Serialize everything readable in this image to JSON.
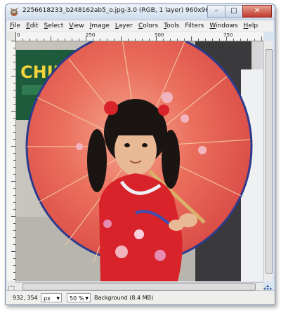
{
  "window": {
    "title": "2256618233_b248162ab5_o.jpg-3.0 (RGB, 1 layer) 960x960 – GIMP",
    "buttons": {
      "minimize": "–",
      "maximize": "□",
      "close": "✕"
    }
  },
  "menubar": {
    "items": [
      {
        "label": "File",
        "u": "F",
        "rest": "ile"
      },
      {
        "label": "Edit",
        "u": "E",
        "rest": "dit"
      },
      {
        "label": "Select",
        "u": "S",
        "rest": "elect"
      },
      {
        "label": "View",
        "u": "V",
        "rest": "iew"
      },
      {
        "label": "Image",
        "u": "I",
        "rest": "mage"
      },
      {
        "label": "Layer",
        "u": "L",
        "rest": "ayer"
      },
      {
        "label": "Colors",
        "u": "C",
        "rest": "olors"
      },
      {
        "label": "Tools",
        "u": "T",
        "rest": "ools"
      },
      {
        "label": "Filters",
        "u": "",
        "rest": "Filters"
      },
      {
        "label": "Windows",
        "u": "W",
        "rest": "indows"
      },
      {
        "label": "Help",
        "u": "H",
        "rest": "elp"
      }
    ]
  },
  "rulers": {
    "horizontal_labels": [
      "0",
      "250",
      "500",
      "750"
    ]
  },
  "canvas": {
    "sign_text": "CHINES",
    "colors": {
      "umbrella": "#e8524f",
      "dress": "#d8232a",
      "sign": "#f0d23a"
    }
  },
  "statusbar": {
    "coordinates": "932, 354",
    "unit": "px",
    "zoom": "50 %",
    "layer_info": "Background (8.4 MB)"
  },
  "icons": {
    "app": "gimp-wilber-icon",
    "navigate": "navigate-arrows-icon",
    "quick_mask": "quick-mask-icon"
  }
}
